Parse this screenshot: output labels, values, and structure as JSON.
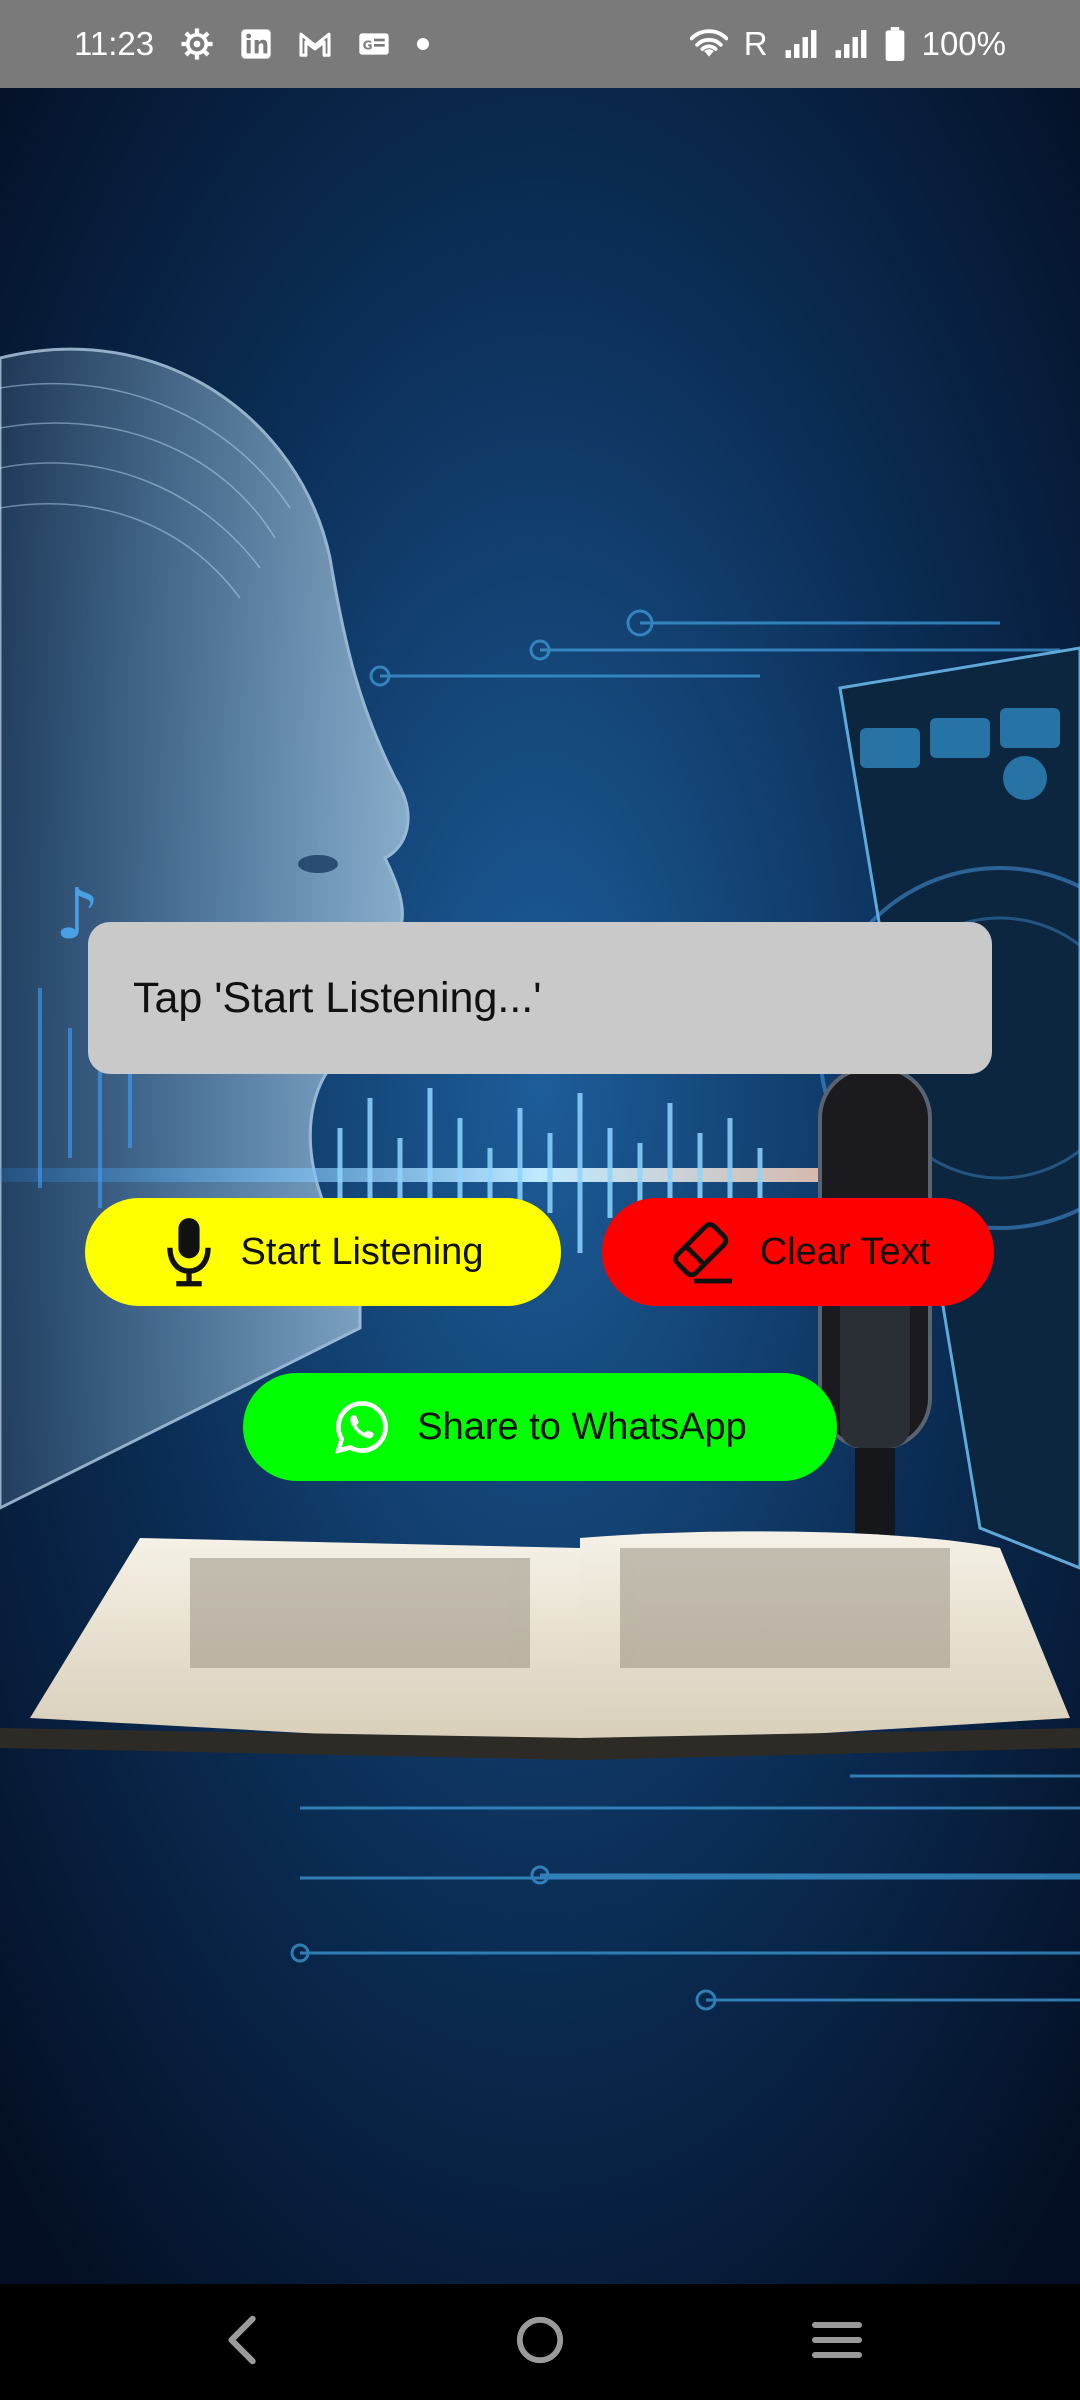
{
  "status_bar": {
    "time": "11:23",
    "left_icons": [
      "settings-icon",
      "linkedin-icon",
      "gmail-icon",
      "news-icon",
      "notification-dot-icon"
    ],
    "roaming": "R",
    "battery": "100%"
  },
  "text_display": {
    "text": "Tap 'Start Listening...'"
  },
  "buttons": {
    "start_listening": {
      "label": "Start Listening",
      "icon": "microphone-icon",
      "color": "#ffff00"
    },
    "clear_text": {
      "label": "Clear Text",
      "icon": "eraser-icon",
      "color": "#ff0000"
    },
    "share_whatsapp": {
      "label": "Share to WhatsApp",
      "icon": "whatsapp-icon",
      "color": "#00ff00"
    }
  },
  "nav_bar": {
    "items": [
      "back-icon",
      "home-icon",
      "recents-icon"
    ]
  }
}
